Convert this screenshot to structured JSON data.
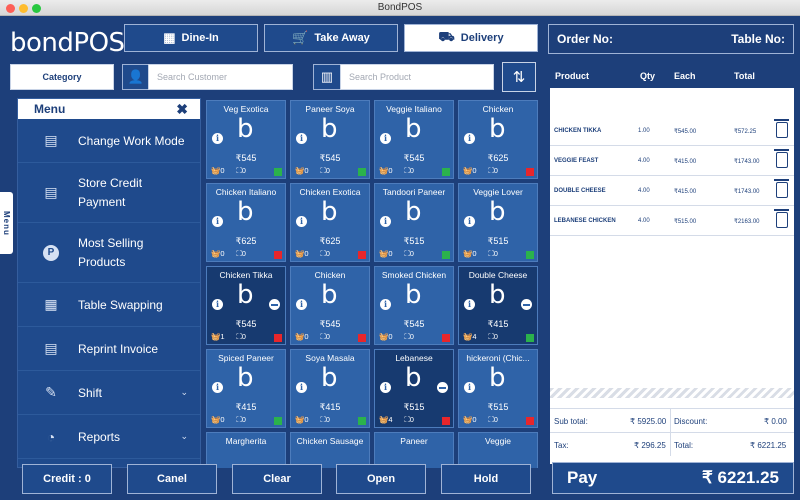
{
  "window": {
    "title": "BondPOS"
  },
  "brand": {
    "logo": "bondPOS"
  },
  "order_types": [
    {
      "label": "Dine-In",
      "icon": "dine-in-icon",
      "active": false
    },
    {
      "label": "Take Away",
      "icon": "cart-icon",
      "active": false
    },
    {
      "label": "Delivery",
      "icon": "delivery-icon",
      "active": true
    }
  ],
  "order_header": {
    "order_no": "Order No:",
    "table_no": "Table No:"
  },
  "filters": {
    "category": "Category",
    "customer_placeholder": "Search Customer",
    "product_placeholder": "Search Product"
  },
  "side_tab": "Menu",
  "menu": {
    "title": "Menu",
    "items": [
      {
        "label": "Change Work Mode",
        "icon": "work-mode-icon"
      },
      {
        "label": "Store Credit Payment",
        "icon": "credit-payment-icon"
      },
      {
        "label": "Most Selling Products",
        "icon": "most-selling-icon"
      },
      {
        "label": "Table Swapping",
        "icon": "table-swap-icon"
      },
      {
        "label": "Reprint Invoice",
        "icon": "invoice-icon"
      },
      {
        "label": "Shift",
        "icon": "shift-icon",
        "expandable": true
      },
      {
        "label": "Reports",
        "icon": "reports-icon",
        "expandable": true
      }
    ]
  },
  "products": [
    {
      "name": "Veg Exotica",
      "price": "₹545",
      "qty": "0",
      "stock": "0",
      "flag": "#2bb24c",
      "selected": false
    },
    {
      "name": "Paneer Soya",
      "price": "₹545",
      "qty": "0",
      "stock": "0",
      "flag": "#2bb24c",
      "selected": false
    },
    {
      "name": "Veggie Italiano",
      "price": "₹545",
      "qty": "0",
      "stock": "0",
      "flag": "#2bb24c",
      "selected": false
    },
    {
      "name": "Chicken",
      "price": "₹625",
      "qty": "0",
      "stock": "0",
      "flag": "#e8262b",
      "selected": false
    },
    {
      "name": "Chicken Italiano",
      "price": "₹625",
      "qty": "0",
      "stock": "0",
      "flag": "#e8262b",
      "selected": false
    },
    {
      "name": "Chicken Exotica",
      "price": "₹625",
      "qty": "0",
      "stock": "0",
      "flag": "#e8262b",
      "selected": false
    },
    {
      "name": "Tandoori Paneer",
      "price": "₹515",
      "qty": "0",
      "stock": "0",
      "flag": "#2bb24c",
      "selected": false
    },
    {
      "name": "Veggie Lover",
      "price": "₹515",
      "qty": "0",
      "stock": "0",
      "flag": "#2bb24c",
      "selected": false
    },
    {
      "name": "Chicken Tikka",
      "price": "₹545",
      "qty": "1",
      "stock": "0",
      "flag": "#e8262b",
      "selected": true
    },
    {
      "name": "Chicken",
      "price": "₹545",
      "qty": "0",
      "stock": "0",
      "flag": "#e8262b",
      "selected": false
    },
    {
      "name": "Smoked Chicken",
      "price": "₹545",
      "qty": "0",
      "stock": "0",
      "flag": "#e8262b",
      "selected": false
    },
    {
      "name": "Double Cheese",
      "price": "₹415",
      "qty": "4",
      "stock": "0",
      "flag": "#2bb24c",
      "selected": true
    },
    {
      "name": "Spiced Paneer",
      "price": "₹415",
      "qty": "0",
      "stock": "0",
      "flag": "#2bb24c",
      "selected": false
    },
    {
      "name": "Soya Masala",
      "price": "₹415",
      "qty": "0",
      "stock": "0",
      "flag": "#2bb24c",
      "selected": false
    },
    {
      "name": "Lebanese",
      "price": "₹515",
      "qty": "4",
      "stock": "0",
      "flag": "#e8262b",
      "selected": true
    },
    {
      "name": "hickeroni (Chic...",
      "price": "₹515",
      "qty": "0",
      "stock": "0",
      "flag": "#e8262b",
      "selected": false
    },
    {
      "name": "Margherita",
      "price": "",
      "qty": "",
      "stock": "",
      "flag": "",
      "selected": false
    },
    {
      "name": "Chicken Sausage",
      "price": "",
      "qty": "",
      "stock": "",
      "flag": "",
      "selected": false
    },
    {
      "name": "Paneer",
      "price": "",
      "qty": "",
      "stock": "",
      "flag": "",
      "selected": false
    },
    {
      "name": "Veggie",
      "price": "",
      "qty": "",
      "stock": "",
      "flag": "",
      "selected": false
    }
  ],
  "cart": {
    "columns": [
      "Product",
      "Qty",
      "Each",
      "Total"
    ],
    "rows": [
      {
        "product": "CHICKEN TIKKA",
        "qty": "1.00",
        "each": "₹545.00",
        "total": "₹572.25"
      },
      {
        "product": "VEGGIE FEAST",
        "qty": "4.00",
        "each": "₹415.00",
        "total": "₹1743.00"
      },
      {
        "product": "DOUBLE CHEESE",
        "qty": "4.00",
        "each": "₹415.00",
        "total": "₹1743.00"
      },
      {
        "product": "LEBANESE CHICKEN",
        "qty": "4.00",
        "each": "₹515.00",
        "total": "₹2163.00"
      }
    ]
  },
  "totals": {
    "subtotal_label": "Sub total:",
    "subtotal": "₹ 5925.00",
    "discount_label": "Discount:",
    "discount": "₹ 0.00",
    "tax_label": "Tax:",
    "tax": "₹ 296.25",
    "total_label": "Total:",
    "total": "₹ 6221.25"
  },
  "actions": {
    "credit": "Credit : 0",
    "cancel": "Canel",
    "clear": "Clear",
    "open": "Open",
    "hold": "Hold"
  },
  "pay": {
    "label": "Pay",
    "amount": "₹ 6221.25"
  },
  "colors": {
    "background": "#1d3f7a",
    "card": "#2f63a8",
    "accent_white": "#ffffff",
    "in_stock": "#2bb24c",
    "out_stock": "#e8262b"
  }
}
